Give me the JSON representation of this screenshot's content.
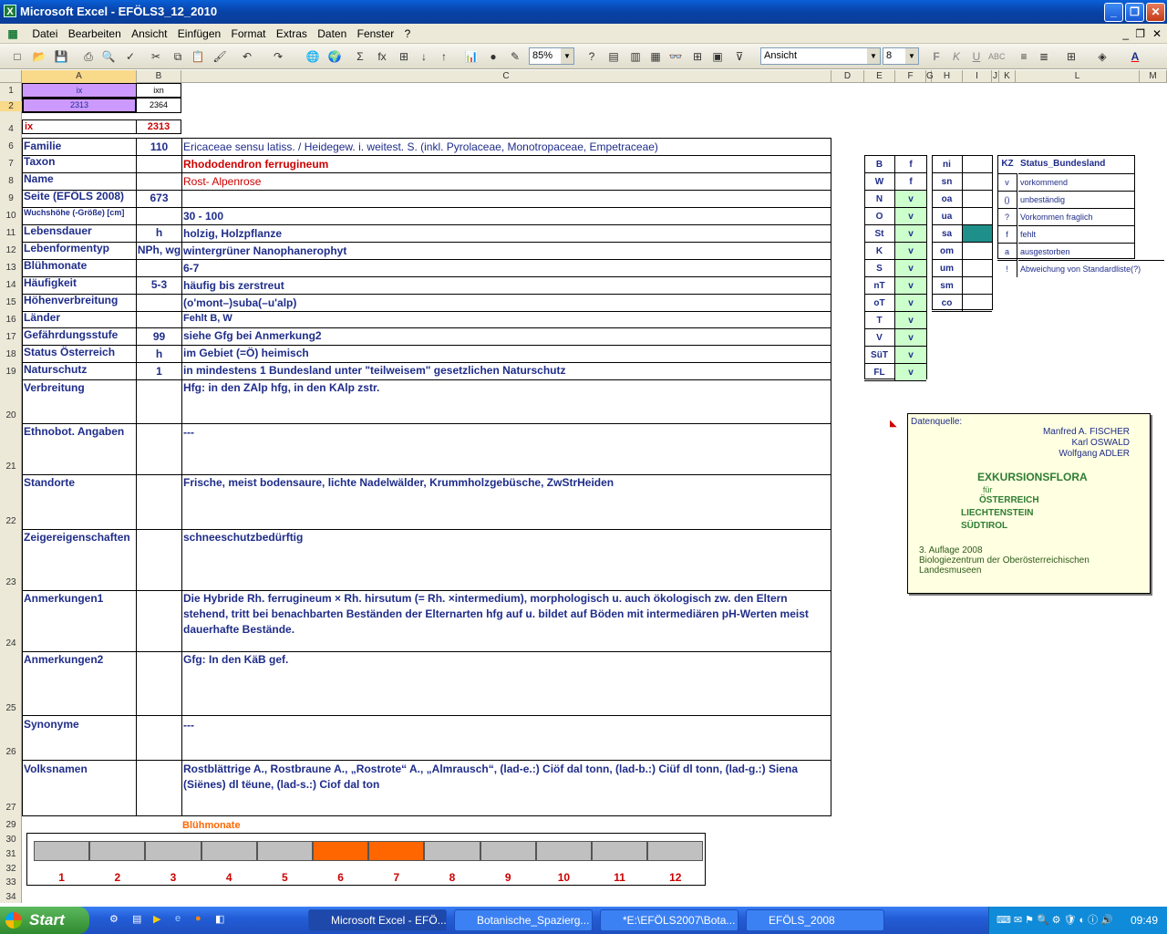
{
  "window": {
    "title": "Microsoft Excel - EFÖLS3_12_2010",
    "app_icon": "excel-icon"
  },
  "menu": [
    "Datei",
    "Bearbeiten",
    "Ansicht",
    "Einfügen",
    "Format",
    "Extras",
    "Daten",
    "Fenster",
    "?"
  ],
  "toolbar": {
    "zoom": "85%",
    "style": "Ansicht",
    "font": "Arial",
    "size": "8"
  },
  "columns": [
    "A",
    "B",
    "C",
    "D",
    "E",
    "F",
    "G",
    "H",
    "I",
    "J",
    "K",
    "L",
    "M"
  ],
  "rows": [
    "1",
    "2",
    "4",
    "6",
    "7",
    "8",
    "9",
    "10",
    "11",
    "12",
    "13",
    "14",
    "15",
    "16",
    "17",
    "18",
    "19",
    "20",
    "21",
    "22",
    "23",
    "24",
    "25",
    "26",
    "27",
    "29",
    "30",
    "31",
    "32",
    "33",
    "34"
  ],
  "top": {
    "a1": "ix",
    "b1": "ixn",
    "a2": "2313",
    "b2": "2364",
    "a4": "ix",
    "b4": "2313"
  },
  "fields": [
    {
      "label": "Familie",
      "b": "110",
      "c": "Ericaceae sensu latiss.  /  Heidegew. i. weitest. S. (inkl. Pyrolaceae, Monotropaceae, Empetraceae)"
    },
    {
      "label": "Taxon",
      "b": "",
      "c": "Rhododendron ferrugineum"
    },
    {
      "label": "Name",
      "b": "",
      "c": "Rost- Alpenrose"
    },
    {
      "label": "Seite (EFÖLS 2008)",
      "b": "673",
      "c": ""
    },
    {
      "label": "Wuchshöhe (-Größe) [cm]",
      "b": "",
      "c": " 30 - 100"
    },
    {
      "label": "Lebensdauer",
      "b": "h",
      "c": "holzig, Holzpflanze"
    },
    {
      "label": "Lebenformentyp",
      "b": "NPh, wg",
      "c": "wintergrüner Nanophanerophyt"
    },
    {
      "label": "Blühmonate",
      "b": "",
      "c": " 6-7"
    },
    {
      "label": "Häufigkeit",
      "b": "5-3",
      "c": "häufig bis zerstreut"
    },
    {
      "label": "Höhenverbreitung",
      "b": "",
      "c": "(o'mont–)suba(–u'alp)"
    },
    {
      "label": "Länder",
      "b": "",
      "c": "Fehlt B, W"
    },
    {
      "label": "Gefährdungsstufe",
      "b": "99",
      "c": "siehe Gfg bei Anmerkung2"
    },
    {
      "label": "Status Österreich",
      "b": "h",
      "c": "im Gebiet (=Ö) heimisch"
    },
    {
      "label": "Naturschutz",
      "b": "1",
      "c": "in mindestens 1 Bundesland unter \"teilweisem\" gesetzlichen Naturschutz"
    },
    {
      "label": "Verbreitung",
      "b": "",
      "c": "Hfg:  in den ZAlp hfg, in den KAlp zstr."
    },
    {
      "label": "Ethnobot. Angaben",
      "b": "",
      "c": "---"
    },
    {
      "label": "Standorte",
      "b": "",
      "c": "Frische, meist bodensaure, lichte Nadelwälder, Krummholzgebüsche, ZwStrHeiden"
    },
    {
      "label": "Zeigereigenschaften",
      "b": "",
      "c": "schneeschutzbedürftig"
    },
    {
      "label": "Anmerkungen1",
      "b": "",
      "c": "Die Hybride Rh. ferrugineum × Rh. hirsutum (= Rh. ×intermedium), morphologisch u. auch ökologisch zw. den Eltern stehend, tritt bei benachbarten Beständen der Elternarten hfg auf u. bildet auf Böden mit intermediären pH-Werten meist dauerhafte Bestände."
    },
    {
      "label": "Anmerkungen2",
      "b": "",
      "c": "Gfg: In den KäB gef."
    },
    {
      "label": "Synonyme",
      "b": "",
      "c": "---"
    },
    {
      "label": "Volksnamen",
      "b": "",
      "c": "Rostblättrige A., Rostbraune A., „Rostrote“ A., „Almrausch“, (lad-e.:) Ciöf dal tonn, (lad-b.:) Ciüf dl tonn, (lad-g.:) Siena (Siënes) dl tëune, (lad-s.:) Ciof dal ton"
    }
  ],
  "states": {
    "header": [
      "B",
      "f"
    ],
    "items": [
      {
        "k": "B",
        "v": "f"
      },
      {
        "k": "W",
        "v": "f"
      },
      {
        "k": "N",
        "v": "v"
      },
      {
        "k": "O",
        "v": "v"
      },
      {
        "k": "St",
        "v": "v"
      },
      {
        "k": "K",
        "v": "v"
      },
      {
        "k": "S",
        "v": "v"
      },
      {
        "k": "nT",
        "v": "v"
      },
      {
        "k": "oT",
        "v": "v"
      },
      {
        "k": "T",
        "v": "v"
      },
      {
        "k": "V",
        "v": "v"
      },
      {
        "k": "SüT",
        "v": "v"
      },
      {
        "k": "FL",
        "v": "v"
      }
    ]
  },
  "altitude": [
    "ni",
    "sn",
    "oa",
    "ua",
    "sa",
    "om",
    "um",
    "sm",
    "co"
  ],
  "legend": {
    "header_k": "KZ",
    "header_l": "Status_Bundesland",
    "items": [
      {
        "k": "v",
        "l": "vorkommend"
      },
      {
        "k": "()",
        "l": "unbeständig"
      },
      {
        "k": "?",
        "l": "Vorkommen fraglich"
      },
      {
        "k": "f",
        "l": "fehlt"
      },
      {
        "k": "a",
        "l": "ausgestorben"
      },
      {
        "k": "!",
        "l": "Abweichung von Standardliste(?)"
      }
    ]
  },
  "note": {
    "source_label": "Datenquelle:",
    "authors": [
      "Manfred A. FISCHER",
      "Karl OSWALD",
      "Wolfgang ADLER"
    ],
    "title": "EXKURSIONSFLORA",
    "fuer": "für",
    "countries": [
      "ÖSTERREICH",
      "LIECHTENSTEIN",
      "SÜDTIROL"
    ],
    "edition": "3. Auflage 2008",
    "publisher": "Biologiezentrum der Oberösterreichischen Landesmuseen"
  },
  "bloom": {
    "title": "Blühmonate",
    "months": [
      "1",
      "2",
      "3",
      "4",
      "5",
      "6",
      "7",
      "8",
      "9",
      "10",
      "11",
      "12"
    ],
    "active": [
      6,
      7
    ],
    "active_color": "#ff6600",
    "inactive_color": "#c0c0c0"
  },
  "taskbar": {
    "start": "Start",
    "tasks": [
      "Microsoft Excel - EFÖ...",
      "Botanische_Spazierg...",
      "*E:\\EFÖLS2007\\Bota...",
      "EFÖLS_2008"
    ],
    "clock": "09:49"
  }
}
